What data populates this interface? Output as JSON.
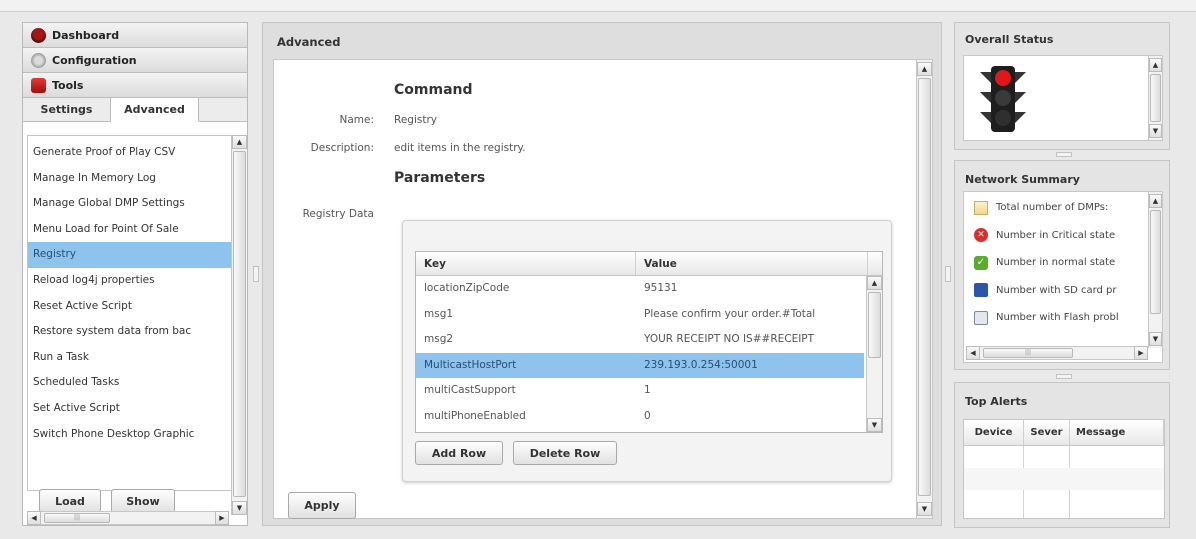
{
  "nav": {
    "items": [
      {
        "label": "Dashboard",
        "icon": "dashboard-icon"
      },
      {
        "label": "Configuration",
        "icon": "configuration-icon"
      },
      {
        "label": "Tools",
        "icon": "toolbox-icon"
      }
    ]
  },
  "tabs": {
    "settings": "Settings",
    "advanced": "Advanced"
  },
  "commands": [
    "Generate Proof of Play CSV",
    "Manage In Memory Log",
    "Manage Global DMP Settings",
    "Menu Load for Point Of Sale",
    "Registry",
    "Reload log4j properties",
    "Reset Active Script",
    "Restore system data from bac",
    "Run a Task",
    "Scheduled Tasks",
    "Set Active Script",
    "Switch Phone Desktop Graphic"
  ],
  "selected_command": "Registry",
  "left_buttons": {
    "load": "Load",
    "show": "Show"
  },
  "advanced": {
    "title": "Advanced",
    "command_heading": "Command",
    "name_label": "Name:",
    "name_value": "Registry",
    "description_label": "Description:",
    "description_value": "edit items in the registry.",
    "parameters_heading": "Parameters",
    "registry_label": "Registry Data",
    "grid_headers": {
      "key": "Key",
      "value": "Value"
    },
    "rows": [
      {
        "key": "locationZipCode",
        "value": "95131"
      },
      {
        "key": "msg1",
        "value": "Please confirm your order.#Total"
      },
      {
        "key": "msg2",
        "value": "YOUR RECEIPT NO IS##RECEIPT"
      },
      {
        "key": "MulticastHostPort",
        "value": "239.193.0.254:50001"
      },
      {
        "key": "multiCastSupport",
        "value": "1"
      },
      {
        "key": "multiPhoneEnabled",
        "value": "0"
      }
    ],
    "selected_row": "MulticastHostPort",
    "add_row": "Add Row",
    "delete_row": "Delete Row",
    "apply": "Apply"
  },
  "overall_status": {
    "title": "Overall Status",
    "icon": "traffic-light-icon",
    "light": "red"
  },
  "network_summary": {
    "title": "Network Summary",
    "items": [
      {
        "label": "Total number of DMPs:",
        "icon": "dmp-list-icon"
      },
      {
        "label": "Number in Critical state",
        "icon": "critical-icon"
      },
      {
        "label": "Number in normal state",
        "icon": "normal-check-icon"
      },
      {
        "label": "Number with SD card pr",
        "icon": "sd-card-icon"
      },
      {
        "label": "Number with Flash probl",
        "icon": "flash-icon"
      }
    ]
  },
  "top_alerts": {
    "title": "Top Alerts",
    "headers": {
      "device": "Device",
      "severity": "Sever",
      "message": "Message"
    }
  },
  "colors": {
    "selection": "#8ec3ee",
    "critical": "#d9302a",
    "normal": "#5aab2e",
    "sd": "#2b57a8"
  }
}
